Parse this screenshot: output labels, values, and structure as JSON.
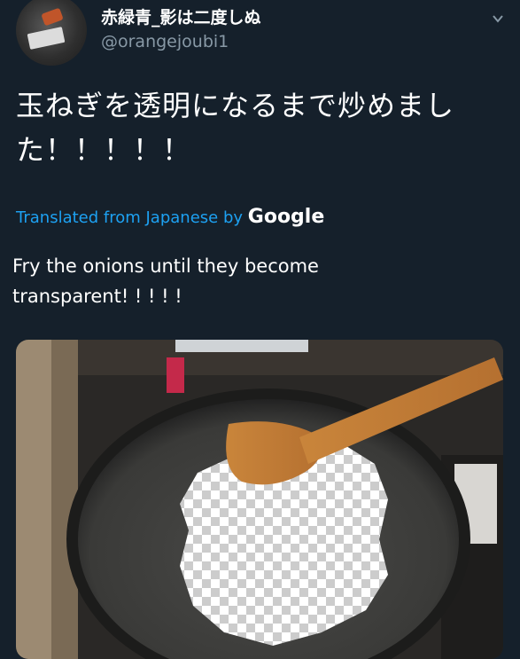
{
  "tweet": {
    "display_name": "赤緑青_影は二度しぬ",
    "handle": "@orangejoubi1",
    "text": "玉ねぎを透明になるまで炒めました！！！！！",
    "translated_prefix": "Translated from Japanese by",
    "translated_brand": "Google",
    "translation": "Fry the onions until they become transparent! ! ! ! !"
  },
  "icons": {
    "avatar": "avatar-image",
    "menu": "chevron-down-icon"
  },
  "colors": {
    "background": "#15202b",
    "link": "#1da1f2",
    "secondary_text": "#8899a6"
  }
}
